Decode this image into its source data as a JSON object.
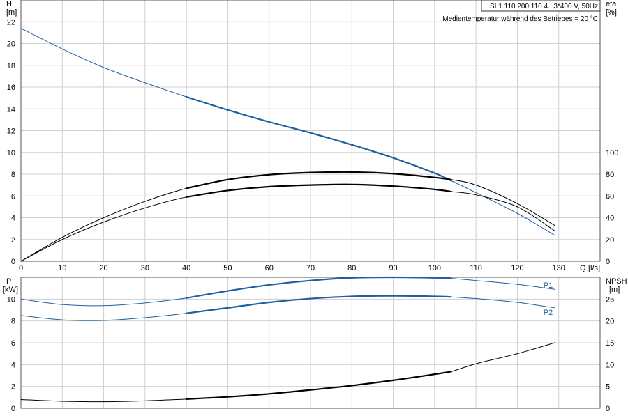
{
  "header": {
    "model": "SL1.110.200.110.4., 3*400 V, 50Hz",
    "temperature_note": "Medientemperatur während des Betriebes = 20 °C"
  },
  "chart_data": [
    {
      "type": "line",
      "name": "upper",
      "x_axis": {
        "label": "Q",
        "unit": "[l/s]",
        "range": [
          0,
          140
        ],
        "ticks": [
          0,
          10,
          20,
          30,
          40,
          50,
          60,
          70,
          80,
          90,
          100,
          110,
          120,
          130
        ]
      },
      "y_left": {
        "label": "H",
        "unit": "[m]",
        "range": [
          0,
          24
        ],
        "ticks": [
          0,
          2,
          4,
          6,
          8,
          10,
          12,
          14,
          16,
          18,
          20,
          22
        ]
      },
      "y_right": {
        "label": "eta",
        "unit": "[%]",
        "range": [
          0,
          240
        ],
        "ticks": [
          0,
          20,
          40,
          60,
          80,
          100
        ]
      },
      "grid": true,
      "series": [
        {
          "id": "H",
          "axis": "left",
          "x": [
            0,
            10,
            20,
            30,
            40,
            50,
            60,
            70,
            80,
            90,
            100,
            104,
            110,
            120,
            129
          ],
          "y": [
            21.4,
            19.5,
            17.8,
            16.4,
            15.1,
            13.9,
            12.8,
            11.8,
            10.7,
            9.5,
            8.1,
            7.4,
            6.3,
            4.4,
            2.4
          ],
          "bold_from": 40,
          "bold_to": 104,
          "color": "#1f5f9f"
        },
        {
          "id": "eta",
          "axis": "right",
          "x": [
            0,
            10,
            20,
            30,
            40,
            50,
            60,
            70,
            80,
            90,
            100,
            104,
            110,
            120,
            129
          ],
          "y": [
            0,
            22,
            40,
            55,
            67,
            75,
            79.5,
            81.5,
            82,
            80.5,
            77,
            75,
            70,
            53,
            33
          ],
          "bold_from": 40,
          "bold_to": 104,
          "color": "#000000"
        },
        {
          "id": "eta2",
          "axis": "right",
          "x": [
            0,
            10,
            20,
            30,
            40,
            50,
            60,
            70,
            80,
            90,
            100,
            104,
            110,
            120,
            129
          ],
          "y": [
            0,
            20,
            36,
            49,
            59,
            65,
            68.5,
            70,
            70.5,
            69,
            66,
            64,
            61,
            50,
            28
          ],
          "bold_from": 40,
          "bold_to": 104,
          "color": "#000000"
        }
      ]
    },
    {
      "type": "line",
      "name": "lower",
      "x_axis": {
        "range": [
          0,
          140
        ]
      },
      "y_left": {
        "label": "P",
        "unit": "[kW]",
        "range": [
          0,
          12
        ],
        "ticks": [
          0,
          2,
          4,
          6,
          8,
          10
        ]
      },
      "y_right": {
        "label": "NPSH",
        "unit": "[m]",
        "range": [
          0,
          30
        ],
        "ticks": [
          0,
          5,
          10,
          15,
          20,
          25
        ]
      },
      "grid": true,
      "series": [
        {
          "id": "P1",
          "name": "P1",
          "axis": "left",
          "x": [
            0,
            10,
            20,
            30,
            40,
            50,
            60,
            70,
            80,
            90,
            100,
            104,
            110,
            120,
            129
          ],
          "y": [
            10.0,
            9.5,
            9.4,
            9.65,
            10.1,
            10.75,
            11.3,
            11.7,
            11.95,
            12.0,
            11.95,
            11.9,
            11.7,
            11.35,
            10.9
          ],
          "bold_from": 40,
          "bold_to": 104,
          "color": "#1f5f9f"
        },
        {
          "id": "P2",
          "name": "P2",
          "axis": "left",
          "x": [
            0,
            10,
            20,
            30,
            40,
            50,
            60,
            70,
            80,
            90,
            100,
            104,
            110,
            120,
            129
          ],
          "y": [
            8.5,
            8.1,
            8.05,
            8.3,
            8.7,
            9.2,
            9.7,
            10.05,
            10.25,
            10.3,
            10.25,
            10.2,
            10.05,
            9.7,
            9.2
          ],
          "bold_from": 40,
          "bold_to": 104,
          "color": "#1f5f9f"
        },
        {
          "id": "NPSH",
          "axis": "right",
          "x": [
            0,
            10,
            20,
            30,
            40,
            50,
            60,
            70,
            80,
            90,
            100,
            104,
            110,
            120,
            129
          ],
          "y": [
            2.0,
            1.6,
            1.5,
            1.7,
            2.1,
            2.6,
            3.3,
            4.2,
            5.2,
            6.4,
            7.8,
            8.4,
            10.2,
            12.5,
            15.0
          ],
          "bold_from": 40,
          "bold_to": 104,
          "color": "#000000"
        }
      ]
    }
  ]
}
